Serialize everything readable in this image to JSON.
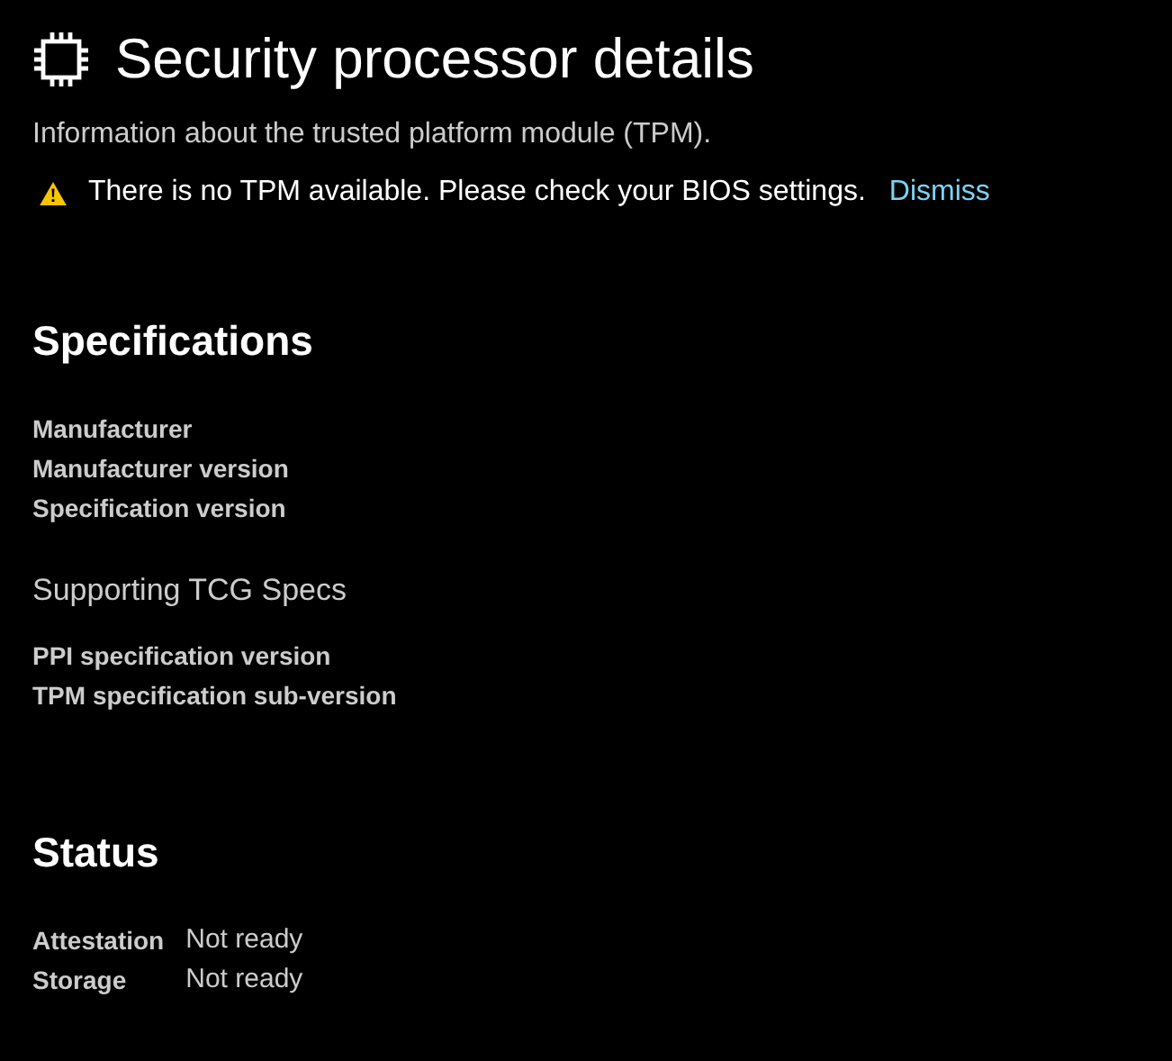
{
  "title": "Security processor details",
  "description": "Information about the trusted platform module (TPM).",
  "warning": {
    "message": "There is no TPM available. Please check your BIOS settings.",
    "action": "Dismiss"
  },
  "specifications": {
    "heading": "Specifications",
    "labels": [
      "Manufacturer",
      "Manufacturer version",
      "Specification version"
    ],
    "subheading": "Supporting TCG Specs",
    "sub_labels": [
      "PPI specification version",
      "TPM specification sub-version"
    ]
  },
  "status": {
    "heading": "Status",
    "rows": [
      {
        "label": "Attestation",
        "value": "Not ready"
      },
      {
        "label": "Storage",
        "value": "Not ready"
      }
    ]
  }
}
